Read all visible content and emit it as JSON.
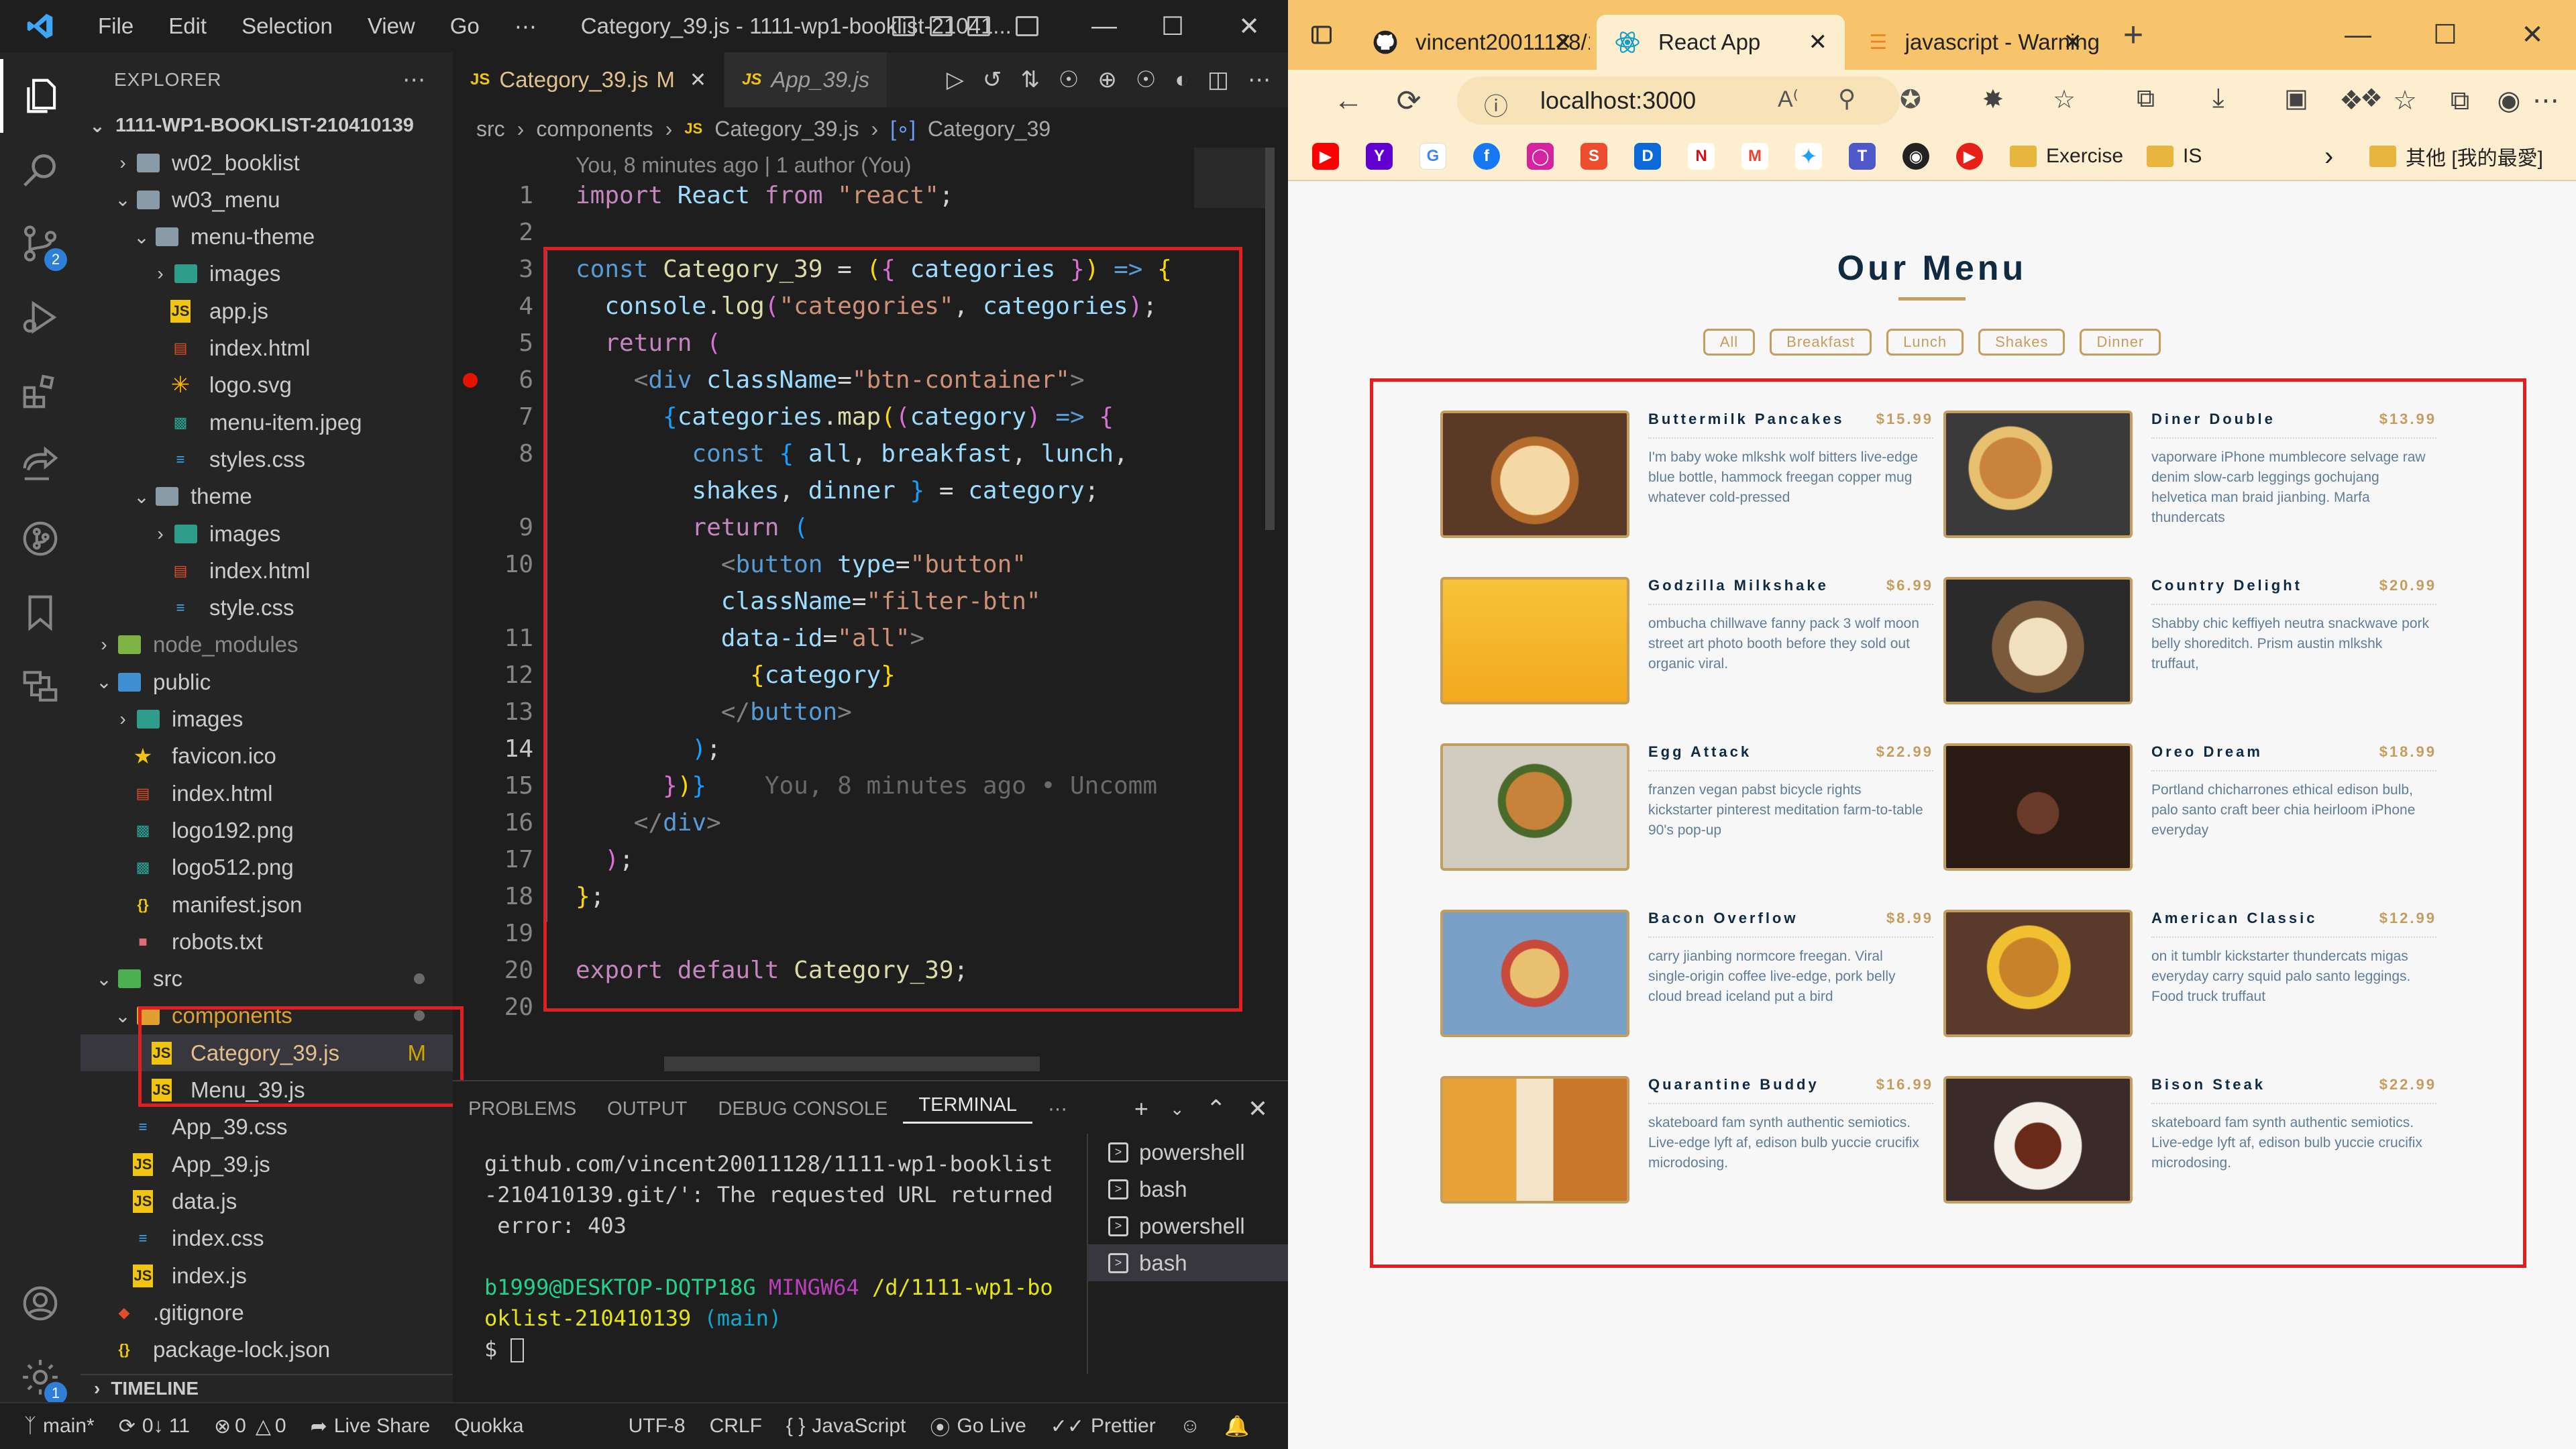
{
  "vscode": {
    "menu": [
      "File",
      "Edit",
      "Selection",
      "View",
      "Go",
      "⋯"
    ],
    "window_title": "Category_39.js - 1111-wp1-booklist-21041...",
    "explorer_label": "EXPLORER",
    "root_folder": "1111-WP1-BOOKLIST-210410139",
    "tree": [
      {
        "label": "w02_booklist",
        "type": "folder",
        "expanded": false,
        "depth": 1
      },
      {
        "label": "w03_menu",
        "type": "folder",
        "expanded": true,
        "depth": 1
      },
      {
        "label": "menu-theme",
        "type": "folder",
        "expanded": true,
        "depth": 2
      },
      {
        "label": "images",
        "type": "imgfolder",
        "expanded": false,
        "depth": 3
      },
      {
        "label": "app.js",
        "type": "js",
        "depth": 3
      },
      {
        "label": "index.html",
        "type": "html",
        "depth": 3
      },
      {
        "label": "logo.svg",
        "type": "svg",
        "depth": 3
      },
      {
        "label": "menu-item.jpeg",
        "type": "img",
        "depth": 3
      },
      {
        "label": "styles.css",
        "type": "css",
        "depth": 3
      },
      {
        "label": "theme",
        "type": "folder",
        "expanded": true,
        "depth": 2
      },
      {
        "label": "images",
        "type": "imgfolder",
        "expanded": false,
        "depth": 3
      },
      {
        "label": "index.html",
        "type": "html",
        "depth": 3
      },
      {
        "label": "style.css",
        "type": "css",
        "depth": 3
      },
      {
        "label": "node_modules",
        "type": "nodefolder",
        "expanded": false,
        "depth": 0
      },
      {
        "label": "public",
        "type": "pubfolder",
        "expanded": true,
        "depth": 0
      },
      {
        "label": "images",
        "type": "imgfolder",
        "expanded": false,
        "depth": 1
      },
      {
        "label": "favicon.ico",
        "type": "ico",
        "depth": 1
      },
      {
        "label": "index.html",
        "type": "html",
        "depth": 1
      },
      {
        "label": "logo192.png",
        "type": "img",
        "depth": 1
      },
      {
        "label": "logo512.png",
        "type": "img",
        "depth": 1
      },
      {
        "label": "manifest.json",
        "type": "json",
        "depth": 1
      },
      {
        "label": "robots.txt",
        "type": "txt",
        "depth": 1
      },
      {
        "label": "src",
        "type": "srcfolder",
        "expanded": true,
        "depth": 0
      },
      {
        "label": "components",
        "type": "compfolder",
        "expanded": true,
        "depth": 1
      },
      {
        "label": "Category_39.js",
        "type": "js",
        "depth": 2,
        "status": "M"
      },
      {
        "label": "Menu_39.js",
        "type": "js",
        "depth": 2
      },
      {
        "label": "App_39.css",
        "type": "css",
        "depth": 1
      },
      {
        "label": "App_39.js",
        "type": "js",
        "depth": 1
      },
      {
        "label": "data.js",
        "type": "js",
        "depth": 1
      },
      {
        "label": "index.css",
        "type": "css",
        "depth": 1
      },
      {
        "label": "index.js",
        "type": "js",
        "depth": 1
      },
      {
        "label": ".gitignore",
        "type": "git",
        "depth": 0
      },
      {
        "label": "package-lock.json",
        "type": "json",
        "depth": 0
      }
    ],
    "timeline_label": "TIMELINE",
    "tabs": [
      {
        "label": "Category_39.js",
        "status": "M",
        "active": true
      },
      {
        "label": "App_39.js",
        "active": false
      }
    ],
    "breadcrumb": [
      "src",
      "components",
      "Category_39.js",
      "Category_39"
    ],
    "blame_header": "You, 8 minutes ago | 1 author (You)",
    "line_numbers": [
      "1",
      "2",
      "3",
      "4",
      "5",
      "6",
      "7",
      "8",
      "",
      "9",
      "10",
      "",
      "11",
      "12",
      "13",
      "14",
      "15",
      "16",
      "17",
      "18",
      "19",
      "20"
    ],
    "current_line": "14",
    "inline_blame": "You, 8 minutes ago • Uncomm",
    "panel_tabs": [
      "PROBLEMS",
      "OUTPUT",
      "DEBUG CONSOLE",
      "TERMINAL",
      "⋯"
    ],
    "terminal": {
      "line1": "github.com/vincent20011128/1111-wp1-booklist",
      "line2": "-210410139.git/': The requested URL returned",
      "line3": " error: 403",
      "prompt_user": "b1999@DESKTOP-DQTP18G",
      "prompt_env": "MINGW64",
      "prompt_path": "/d/1111-wp1-bo",
      "prompt_path2": "oklist-210410139",
      "prompt_branch": "(main)",
      "prompt_symbol": "$"
    },
    "shells": [
      "powershell",
      "bash",
      "powershell",
      "bash"
    ],
    "status": {
      "branch": "main*",
      "sync": "0↓ 11",
      "problems": "0",
      "warnings": "0",
      "live_share": "Live Share",
      "quokka": "Quokka",
      "encoding": "UTF-8",
      "eol": "CRLF",
      "language": "JavaScript",
      "go_live": "Go Live",
      "prettier": "Prettier"
    },
    "badges": {
      "scm": "2",
      "settings": "1"
    }
  },
  "browser": {
    "tabs": [
      {
        "label": "vincent20011128/1",
        "active": false
      },
      {
        "label": "React App",
        "active": true
      },
      {
        "label": "javascript - Warning",
        "active": false
      }
    ],
    "url": "localhost:3000",
    "bookmarks": [
      "Exercise",
      "IS",
      "其他 [我的最愛]"
    ],
    "page": {
      "title": "Our Menu",
      "filters": [
        "All",
        "Breakfast",
        "Lunch",
        "Shakes",
        "Dinner"
      ],
      "items": [
        {
          "name": "Buttermilk Pancakes",
          "price": "$15.99",
          "desc": "I'm baby woke mlkshk wolf bitters live-edge blue bottle, hammock freegan copper mug whatever cold-pressed"
        },
        {
          "name": "Diner Double",
          "price": "$13.99",
          "desc": "vaporware iPhone mumblecore selvage raw denim slow-carb leggings gochujang helvetica man braid jianbing. Marfa thundercats"
        },
        {
          "name": "Godzilla Milkshake",
          "price": "$6.99",
          "desc": "ombucha chillwave fanny pack 3 wolf moon street art photo booth before they sold out organic viral."
        },
        {
          "name": "Country Delight",
          "price": "$20.99",
          "desc": "Shabby chic keffiyeh neutra snackwave pork belly shoreditch. Prism austin mlkshk truffaut,"
        },
        {
          "name": "Egg Attack",
          "price": "$22.99",
          "desc": "franzen vegan pabst bicycle rights kickstarter pinterest meditation farm-to-table 90's pop-up"
        },
        {
          "name": "Oreo Dream",
          "price": "$18.99",
          "desc": "Portland chicharrones ethical edison bulb, palo santo craft beer chia heirloom iPhone everyday"
        },
        {
          "name": "Bacon Overflow",
          "price": "$8.99",
          "desc": "carry jianbing normcore freegan. Viral single-origin coffee live-edge, pork belly cloud bread iceland put a bird"
        },
        {
          "name": "American Classic",
          "price": "$12.99",
          "desc": "on it tumblr kickstarter thundercats migas everyday carry squid palo santo leggings. Food truck truffaut"
        },
        {
          "name": "Quarantine Buddy",
          "price": "$16.99",
          "desc": "skateboard fam synth authentic semiotics. Live-edge lyft af, edison bulb yuccie crucifix microdosing."
        },
        {
          "name": "Bison Steak",
          "price": "$22.99",
          "desc": "skateboard fam synth authentic semiotics. Live-edge lyft af, edison bulb yuccie crucifix microdosing."
        }
      ]
    }
  }
}
